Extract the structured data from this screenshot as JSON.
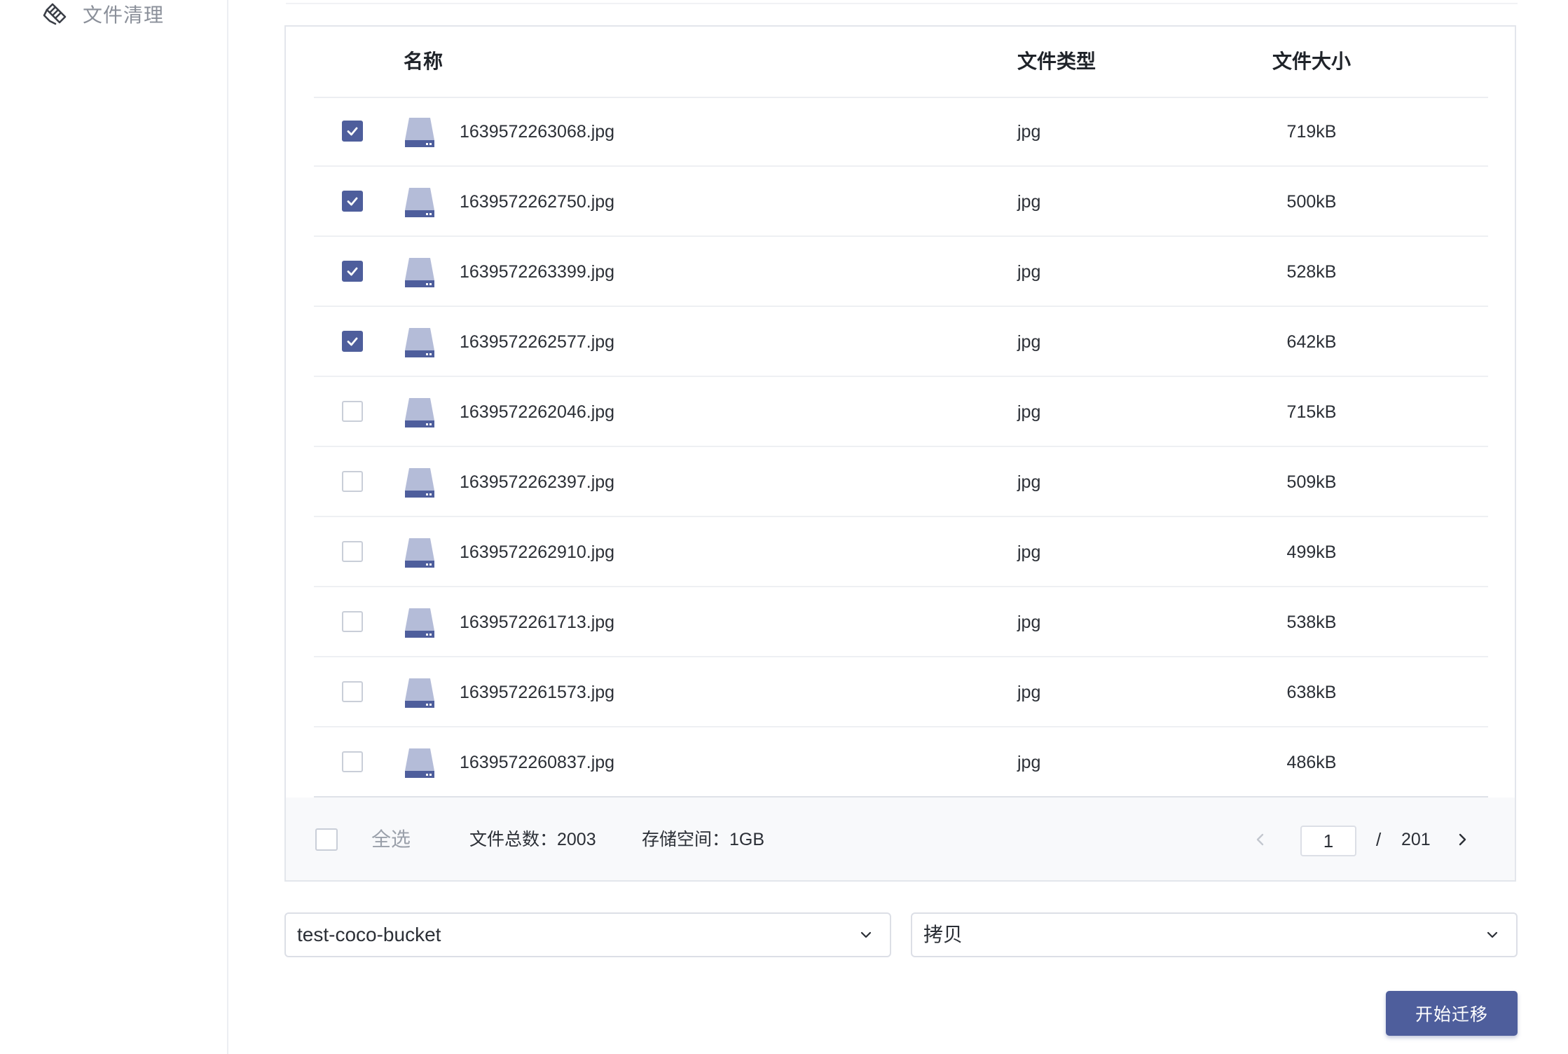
{
  "sidebar": {
    "active_item": {
      "label": "文件清理",
      "icon": "brush-clean-icon"
    }
  },
  "table": {
    "headers": {
      "name": "名称",
      "type": "文件类型",
      "size": "文件大小"
    },
    "rows": [
      {
        "checked": true,
        "name": "1639572263068.jpg",
        "type": "jpg",
        "size": "719kB"
      },
      {
        "checked": true,
        "name": "1639572262750.jpg",
        "type": "jpg",
        "size": "500kB"
      },
      {
        "checked": true,
        "name": "1639572263399.jpg",
        "type": "jpg",
        "size": "528kB"
      },
      {
        "checked": true,
        "name": "1639572262577.jpg",
        "type": "jpg",
        "size": "642kB"
      },
      {
        "checked": false,
        "name": "1639572262046.jpg",
        "type": "jpg",
        "size": "715kB"
      },
      {
        "checked": false,
        "name": "1639572262397.jpg",
        "type": "jpg",
        "size": "509kB"
      },
      {
        "checked": false,
        "name": "1639572262910.jpg",
        "type": "jpg",
        "size": "499kB"
      },
      {
        "checked": false,
        "name": "1639572261713.jpg",
        "type": "jpg",
        "size": "538kB"
      },
      {
        "checked": false,
        "name": "1639572261573.jpg",
        "type": "jpg",
        "size": "638kB"
      },
      {
        "checked": false,
        "name": "1639572260837.jpg",
        "type": "jpg",
        "size": "486kB"
      }
    ]
  },
  "footer": {
    "select_all_label": "全选",
    "select_all_checked": false,
    "total_files": "文件总数：2003",
    "storage_space": "存储空间：1GB"
  },
  "pagination": {
    "current_page": "1",
    "separator": "/",
    "total_pages": "201"
  },
  "controls": {
    "bucket_select": "test-coco-bucket",
    "mode_select": "拷贝",
    "start_button": "开始迁移"
  },
  "colors": {
    "accent": "#4e5e9c",
    "icon_light": "#b4bcd8",
    "border": "#dcdfe6",
    "text": "#2b2f36",
    "muted": "#9aa0aa"
  }
}
